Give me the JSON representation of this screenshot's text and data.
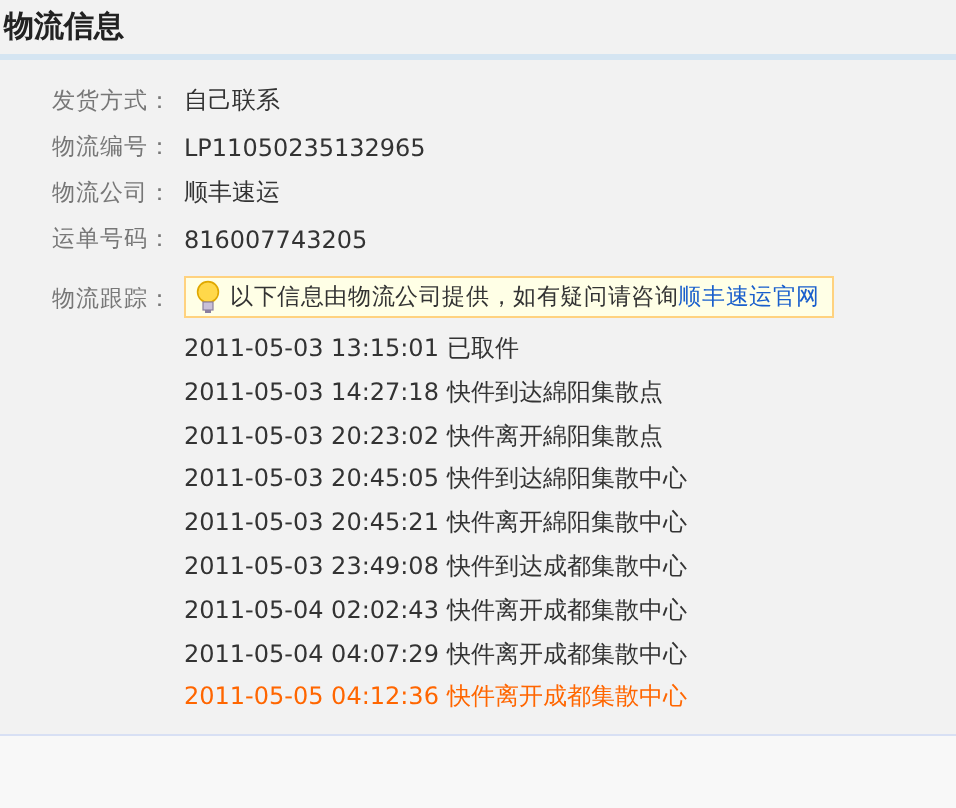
{
  "title": "物流信息",
  "fields": [
    {
      "label": "发货方式：",
      "value": "自己联系"
    },
    {
      "label": "物流编号：",
      "value": "LP11050235132965"
    },
    {
      "label": "物流公司：",
      "value": "顺丰速运"
    },
    {
      "label": "运单号码：",
      "value": "816007743205"
    }
  ],
  "tracking": {
    "label": "物流跟踪：",
    "notice": "以下信息由物流公司提供，如有疑问请咨询",
    "notice_link": "顺丰速运官网",
    "events": [
      {
        "text": "2011-05-03 13:15:01 已取件",
        "current": false
      },
      {
        "text": "2011-05-03 14:27:18 快件到达綿阳集散点",
        "current": false
      },
      {
        "text": "2011-05-03 20:23:02 快件离开綿阳集散点",
        "current": false
      },
      {
        "text": "2011-05-03 20:45:05 快件到达綿阳集散中心",
        "current": false
      },
      {
        "text": "2011-05-03 20:45:21 快件离开綿阳集散中心",
        "current": false
      },
      {
        "text": "2011-05-03 23:49:08 快件到达成都集散中心",
        "current": false
      },
      {
        "text": "2011-05-04 02:02:43 快件离开成都集散中心",
        "current": false
      },
      {
        "text": "2011-05-04 04:07:29 快件离开成都集散中心",
        "current": false
      },
      {
        "text": "2011-05-05 04:12:36 快件离开成都集散中心",
        "current": true
      }
    ]
  }
}
